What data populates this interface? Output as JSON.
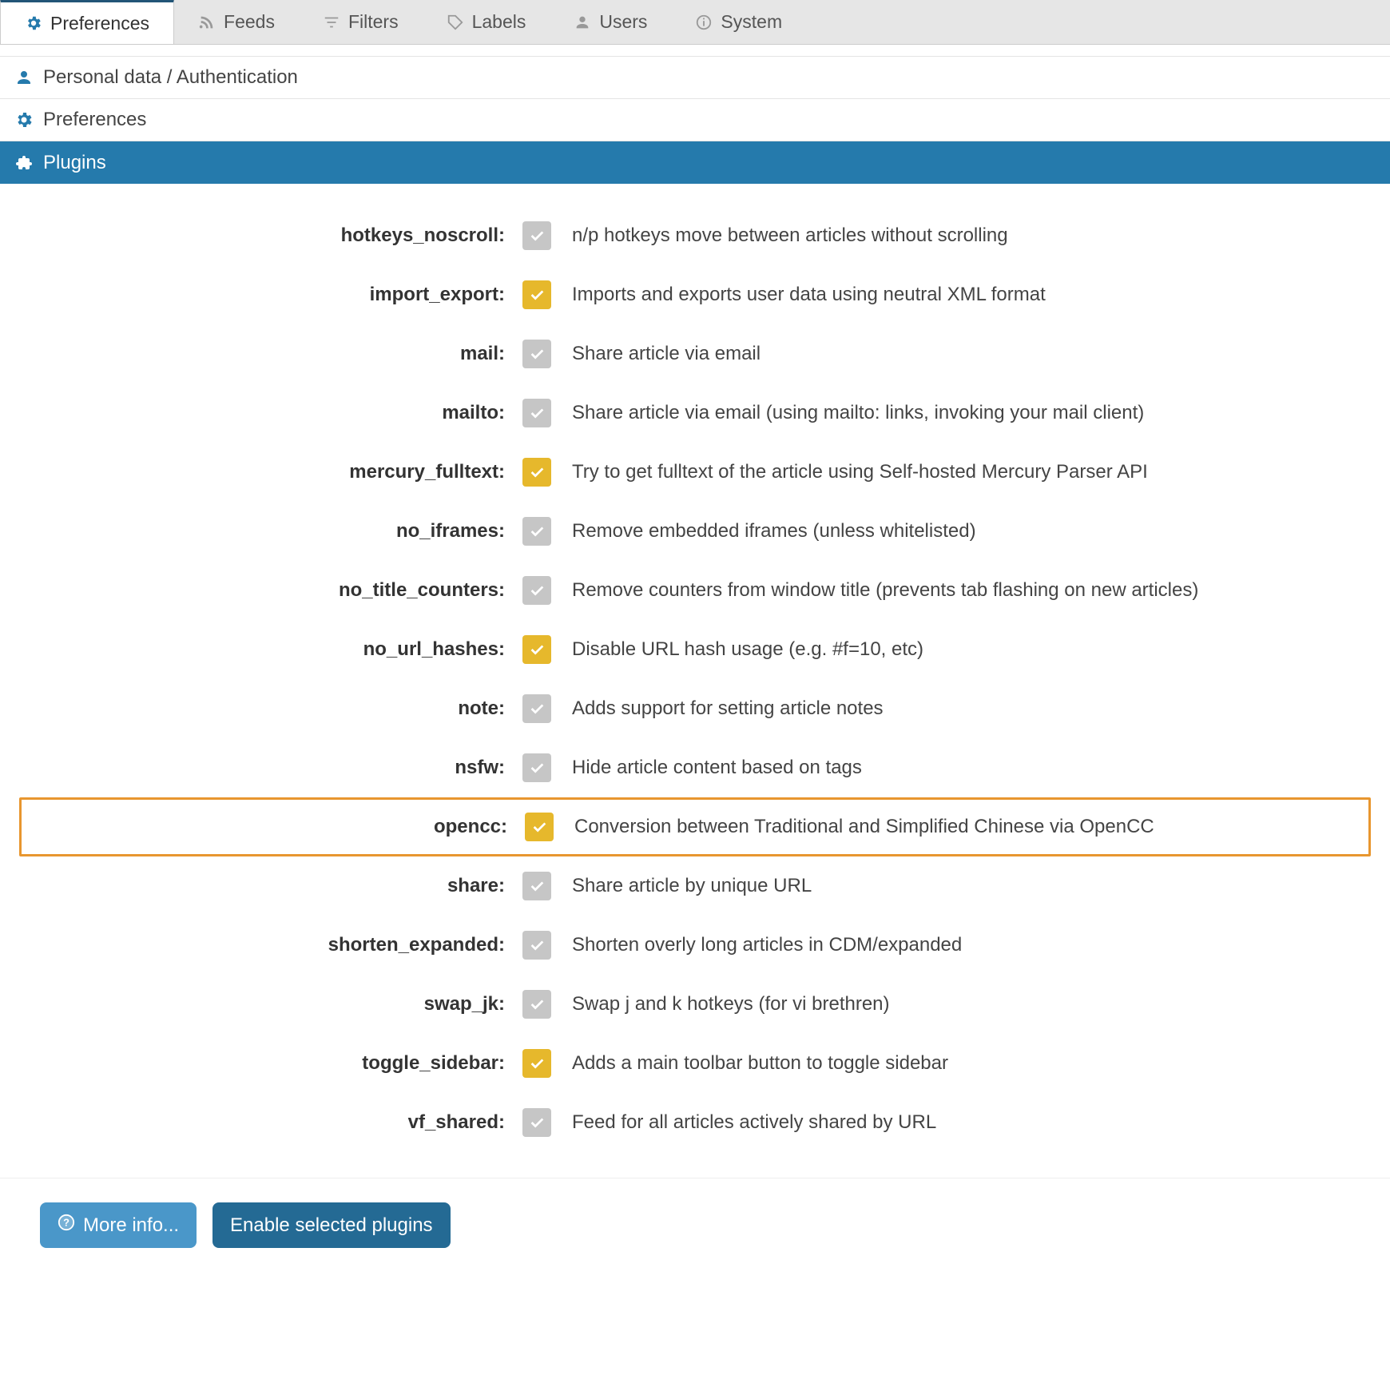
{
  "tabs": [
    {
      "id": "preferences",
      "label": "Preferences"
    },
    {
      "id": "feeds",
      "label": "Feeds"
    },
    {
      "id": "filters",
      "label": "Filters"
    },
    {
      "id": "labels",
      "label": "Labels"
    },
    {
      "id": "users",
      "label": "Users"
    },
    {
      "id": "system",
      "label": "System"
    }
  ],
  "sections": {
    "personal": "Personal data / Authentication",
    "prefs": "Preferences",
    "plugins": "Plugins"
  },
  "plugins": [
    {
      "key": "hotkeys_noscroll",
      "label": "hotkeys_noscroll:",
      "desc": "n/p hotkeys move between articles without scrolling",
      "checked": false
    },
    {
      "key": "import_export",
      "label": "import_export:",
      "desc": "Imports and exports user data using neutral XML format",
      "checked": true
    },
    {
      "key": "mail",
      "label": "mail:",
      "desc": "Share article via email",
      "checked": false
    },
    {
      "key": "mailto",
      "label": "mailto:",
      "desc": "Share article via email (using mailto: links, invoking your mail client)",
      "checked": false
    },
    {
      "key": "mercury_fulltext",
      "label": "mercury_fulltext:",
      "desc": "Try to get fulltext of the article using Self-hosted Mercury Parser API",
      "checked": true
    },
    {
      "key": "no_iframes",
      "label": "no_iframes:",
      "desc": "Remove embedded iframes (unless whitelisted)",
      "checked": false
    },
    {
      "key": "no_title_counters",
      "label": "no_title_counters:",
      "desc": "Remove counters from window title (prevents tab flashing on new articles)",
      "checked": false
    },
    {
      "key": "no_url_hashes",
      "label": "no_url_hashes:",
      "desc": "Disable URL hash usage (e.g. #f=10, etc)",
      "checked": true
    },
    {
      "key": "note",
      "label": "note:",
      "desc": "Adds support for setting article notes",
      "checked": false
    },
    {
      "key": "nsfw",
      "label": "nsfw:",
      "desc": "Hide article content based on tags",
      "checked": false
    },
    {
      "key": "opencc",
      "label": "opencc:",
      "desc": "Conversion between Traditional and Simplified Chinese via OpenCC",
      "checked": true,
      "highlight": true
    },
    {
      "key": "share",
      "label": "share:",
      "desc": "Share article by unique URL",
      "checked": false
    },
    {
      "key": "shorten_expanded",
      "label": "shorten_expanded:",
      "desc": "Shorten overly long articles in CDM/expanded",
      "checked": false
    },
    {
      "key": "swap_jk",
      "label": "swap_jk:",
      "desc": "Swap j and k hotkeys (for vi brethren)",
      "checked": false
    },
    {
      "key": "toggle_sidebar",
      "label": "toggle_sidebar:",
      "desc": "Adds a main toolbar button to toggle sidebar",
      "checked": true
    },
    {
      "key": "vf_shared",
      "label": "vf_shared:",
      "desc": "Feed for all articles actively shared by URL",
      "checked": false
    }
  ],
  "buttons": {
    "more_info": "More info...",
    "enable": "Enable selected plugins"
  }
}
